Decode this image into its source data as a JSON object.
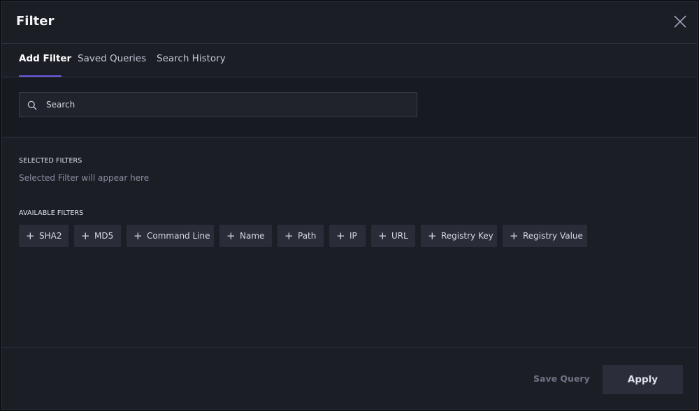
{
  "dialog": {
    "title": "Filter"
  },
  "tabs": [
    {
      "label": "Add Filter",
      "active": true
    },
    {
      "label": "Saved Queries",
      "active": false
    },
    {
      "label": "Search History",
      "active": false
    }
  ],
  "search": {
    "placeholder": "Search",
    "value": ""
  },
  "selected_filters": {
    "heading": "SELECTED FILTERS",
    "empty_text": "Selected Filter will appear here"
  },
  "available_filters": {
    "heading": "AVAILABLE FILTERS",
    "items": [
      {
        "label": "SHA2"
      },
      {
        "label": "MD5"
      },
      {
        "label": "Command Line"
      },
      {
        "label": "Name"
      },
      {
        "label": "Path"
      },
      {
        "label": "IP"
      },
      {
        "label": "URL"
      },
      {
        "label": "Registry Key"
      },
      {
        "label": "Registry Value"
      }
    ]
  },
  "footer": {
    "save_query_label": "Save Query",
    "apply_label": "Apply"
  },
  "colors": {
    "accent": "#6c5ce7",
    "background": "#1c1e26",
    "chip": "#2a2d38"
  }
}
